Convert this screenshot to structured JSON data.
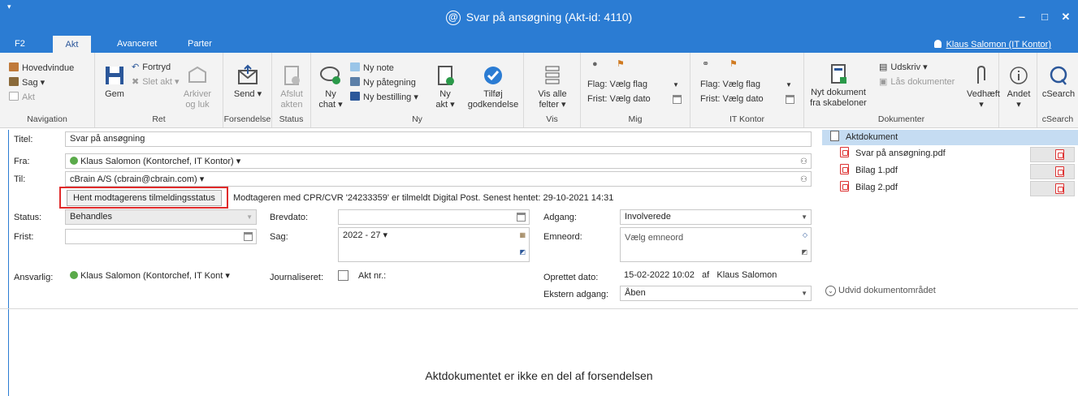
{
  "window": {
    "menu_glyph": "▾",
    "title": "Svar på ansøgning (Akt-id: 4110)",
    "logo": "@",
    "minimize": "‒",
    "maximize": "□",
    "close": "✕"
  },
  "tabs": [
    "F2",
    "Akt",
    "Avanceret",
    "Parter"
  ],
  "user": "Klaus Salomon (IT Kontor)",
  "ribbon": {
    "navigation": {
      "label": "Navigation",
      "items": [
        "Hovedvindue",
        "Sag ▾",
        "Akt"
      ]
    },
    "ret": {
      "label": "Ret",
      "gem": "Gem",
      "fortryd": "Fortryd",
      "slet": "Slet akt ▾",
      "arkiver": "Arkiver og luk"
    },
    "forsendelse": {
      "label": "Forsendelse",
      "send": "Send ▾"
    },
    "status": {
      "label": "Status",
      "afslut": "Afslut akten"
    },
    "ny": {
      "label": "Ny",
      "chat": "Ny chat ▾",
      "note": "Ny note",
      "paategning": "Ny påtegning",
      "bestilling": "Ny bestilling ▾",
      "akt": "Ny akt ▾",
      "godkendelse": "Tilføj godkendelse"
    },
    "vis": {
      "label": "Vis",
      "felter": "Vis alle felter ▾"
    },
    "mig": {
      "label": "Mig",
      "flag_label": "Flag:",
      "flag_value": "Vælg flag",
      "frist_label": "Frist:",
      "frist_value": "Vælg dato"
    },
    "itkontor": {
      "label": "IT Kontor",
      "flag_label": "Flag:",
      "flag_value": "Vælg flag",
      "frist_label": "Frist:",
      "frist_value": "Vælg dato"
    },
    "dokumenter": {
      "label": "Dokumenter",
      "nyt": "Nyt dokument fra skabeloner",
      "udskriv": "Udskriv ▾",
      "laas": "Lås dokumenter",
      "vedhaeft": "Vedhæft ▾"
    },
    "andet": {
      "label": "Andet ▾"
    },
    "csearch": {
      "label": "cSearch",
      "btn": "cSearch"
    }
  },
  "form": {
    "titel_label": "Titel:",
    "titel": "Svar på ansøgning",
    "fra_label": "Fra:",
    "fra": "Klaus Salomon (Kontorchef, IT Kontor) ▾",
    "til_label": "Til:",
    "til": "cBrain A/S (cbrain@cbrain.com) ▾",
    "hent_btn": "Hent modtagerens tilmeldingsstatus",
    "hent_msg": "Modtageren med CPR/CVR '24233359' er tilmeldt Digital Post. Senest hentet: 29-10-2021 14:31",
    "status_label": "Status:",
    "status": "Behandles",
    "brevdato_label": "Brevdato:",
    "brevdato": "",
    "adgang_label": "Adgang:",
    "adgang": "Involverede",
    "frist_label": "Frist:",
    "frist": "",
    "sag_label": "Sag:",
    "sag": "2022 - 27 ▾",
    "emneord_label": "Emneord:",
    "emneord": "Vælg emneord",
    "ansvarlig_label": "Ansvarlig:",
    "ansvarlig": "Klaus Salomon (Kontorchef, IT Kont ▾",
    "journaliseret_label": "Journaliseret:",
    "aktnr_label": "Akt nr.:",
    "oprettet_label": "Oprettet dato:",
    "oprettet": "15-02-2022 10:02",
    "af": "af",
    "oprettet_af": "Klaus Salomon",
    "ekstern_label": "Ekstern adgang:",
    "ekstern": "Åben"
  },
  "documents": {
    "main": "Aktdokument",
    "files": [
      "Svar på ansøgning.pdf",
      "Bilag 1.pdf",
      "Bilag 2.pdf"
    ],
    "expand": "Udvid dokumentområdet"
  },
  "message": "Aktdokumentet er ikke en del af forsendelsen"
}
